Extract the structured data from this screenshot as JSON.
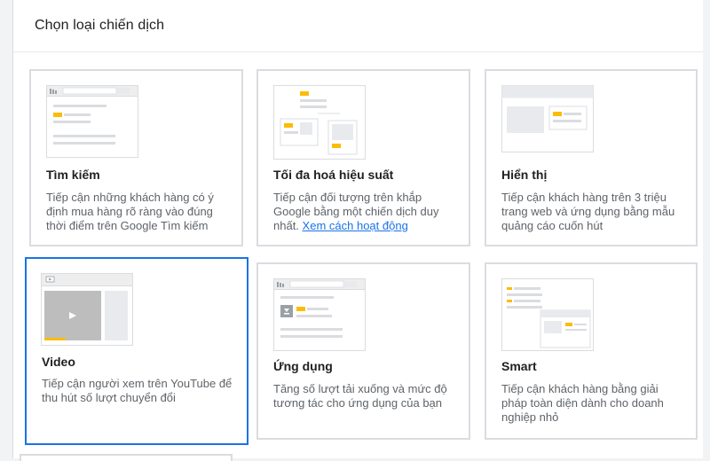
{
  "dialog": {
    "title": "Chọn loại chiến dịch"
  },
  "cards": [
    {
      "name": "Tìm kiếm",
      "desc_lines": [
        "Tiếp cận những khách hàng có ý",
        "định mua hàng rõ ràng vào đúng",
        "thời điểm trên Google Tìm kiếm"
      ],
      "icon": "search-campaign-illustration"
    },
    {
      "name": "Tối đa hoá hiệu suất",
      "desc_lines": [
        "Tiếp cận đối tượng trên khắp",
        "Google bằng một chiến dịch duy",
        "nhất."
      ],
      "link": "Xem cách hoạt động",
      "icon": "performance-max-illustration"
    },
    {
      "name": "Hiển thị",
      "desc_lines": [
        "Tiếp cận khách hàng trên 3 triệu",
        "trang web và ứng dụng bằng mẫu",
        "quảng cáo cuốn hút"
      ],
      "icon": "display-campaign-illustration"
    },
    {
      "name": "Video",
      "desc_lines": [
        "Tiếp cận người xem trên YouTube để",
        "thu hút số lượt chuyển đổi"
      ],
      "icon": "video-campaign-illustration",
      "selected": true
    },
    {
      "name": "Ứng dụng",
      "desc_lines": [
        "Tăng số lượt tải xuống và mức độ",
        "tương tác cho ứng dụng của bạn"
      ],
      "icon": "app-campaign-illustration"
    },
    {
      "name": "Smart",
      "desc_lines": [
        "Tiếp cận khách hàng bằng giải",
        "pháp toàn diện dành cho doanh",
        "nghiệp nhỏ"
      ],
      "icon": "smart-campaign-illustration"
    }
  ],
  "colors": {
    "accent": "#1a73e8",
    "highlight": "#fbbc04",
    "border": "#dadce0"
  }
}
